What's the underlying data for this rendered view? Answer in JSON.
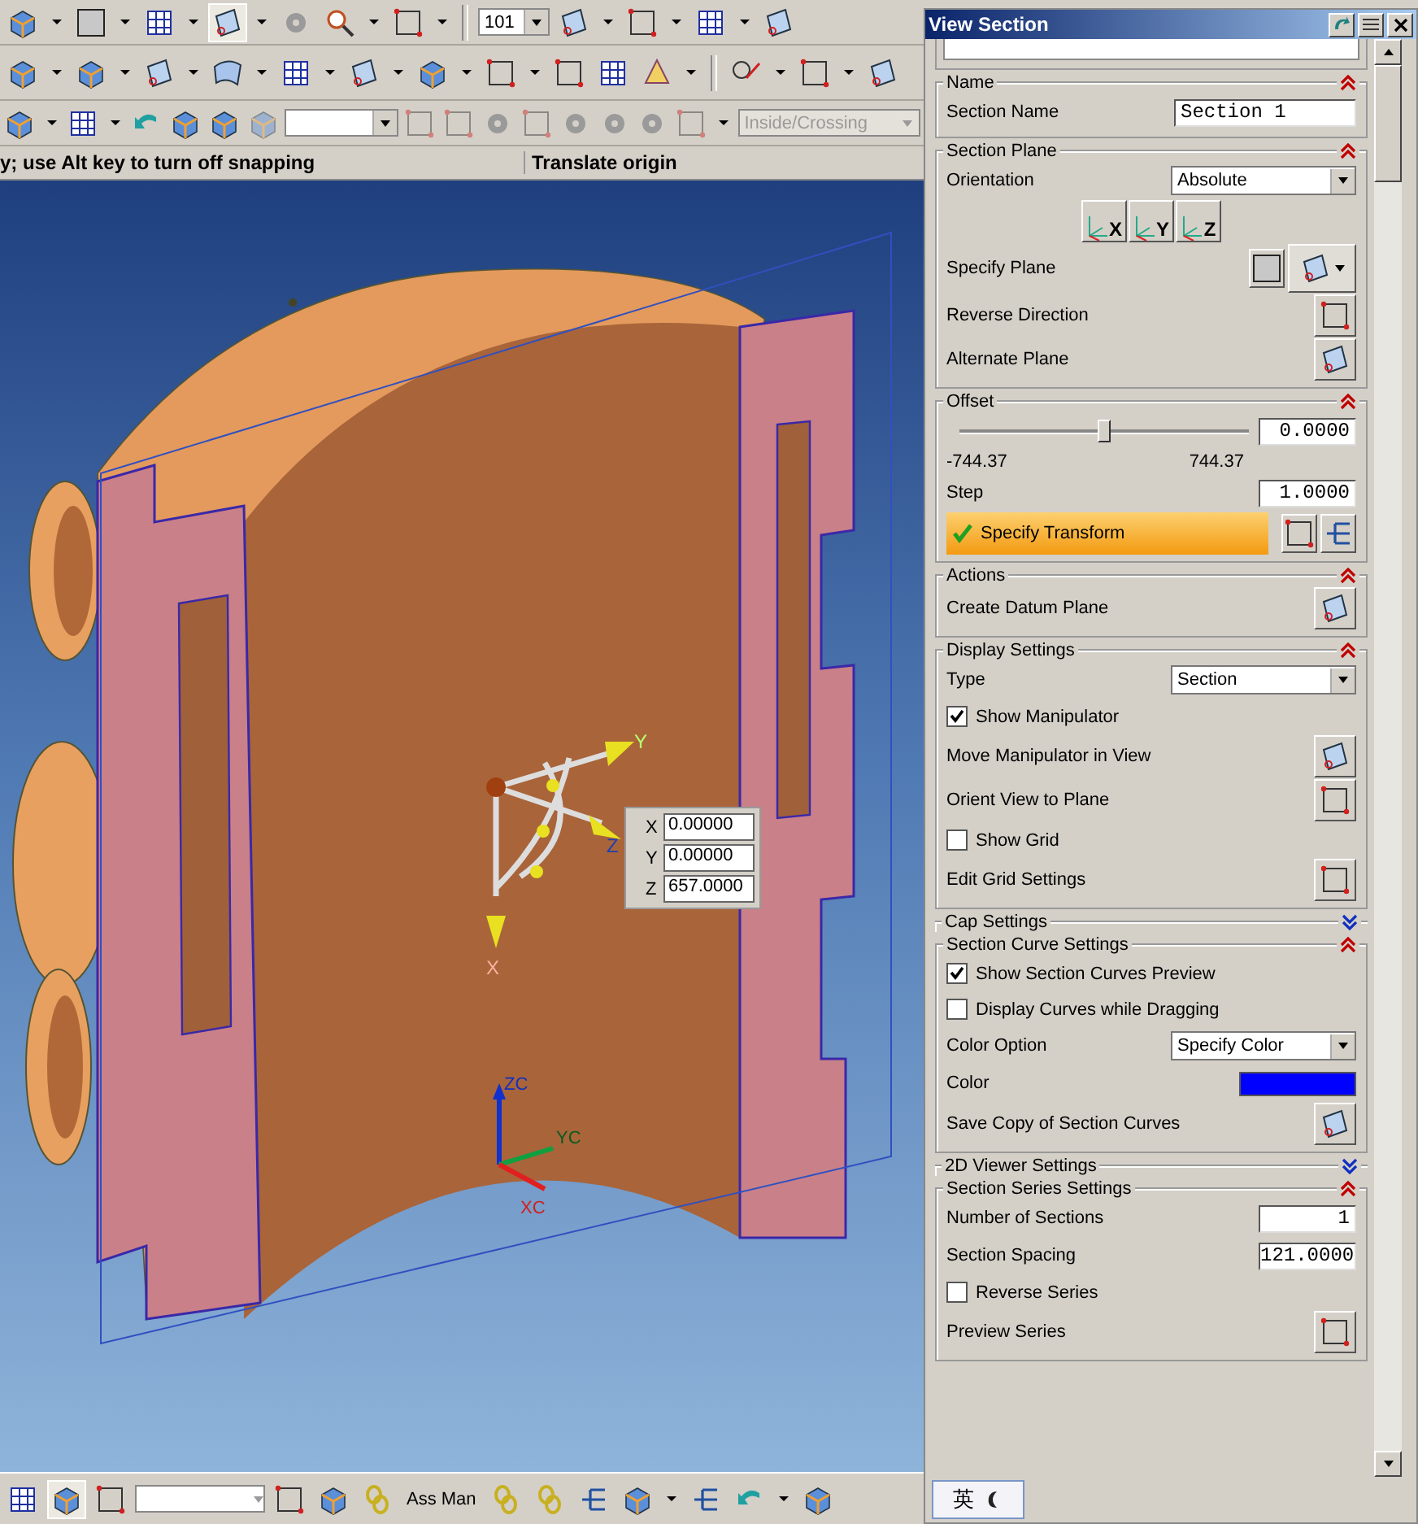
{
  "toolbar": {
    "layer": "101",
    "selection_filter": "Inside/Crossing"
  },
  "status_bar": {
    "prompt": "y; use Alt key to turn off snapping",
    "status": "Translate origin"
  },
  "viewport": {
    "manipulator_axes": [
      "Y",
      "Z",
      "X"
    ],
    "coordinates": [
      {
        "label": "X",
        "value": "0.00000"
      },
      {
        "label": "Y",
        "value": "0.00000"
      },
      {
        "label": "Z",
        "value": "657.0000"
      }
    ],
    "triad_axes": [
      "ZC",
      "YC",
      "XC"
    ]
  },
  "bottom_toolbar": {
    "assembly_button": "Ass Man"
  },
  "dialog": {
    "title": "View Section",
    "groups": [
      {
        "title": "Name",
        "expanded": true,
        "rows": [
          {
            "kind": "text_field",
            "label": "Section Name",
            "value": "Section 1"
          }
        ]
      },
      {
        "title": "Section Plane",
        "expanded": true,
        "rows": [
          {
            "kind": "dropdown",
            "label": "Orientation",
            "value": "Absolute"
          },
          {
            "kind": "axis_buttons",
            "labels": [
              "X",
              "Y",
              "Z"
            ]
          },
          {
            "kind": "plane_selector",
            "label": "Specify Plane"
          },
          {
            "kind": "icon_button",
            "label": "Reverse Direction"
          },
          {
            "kind": "icon_button",
            "label": "Alternate Plane"
          }
        ]
      },
      {
        "title": "Offset",
        "expanded": true,
        "rows": [
          {
            "kind": "slider",
            "level": 0.5,
            "min": "-744.37",
            "max": "744.37",
            "value": "0.0000"
          },
          {
            "kind": "number_field",
            "label": "Step",
            "value": "1.0000"
          },
          {
            "kind": "transform",
            "label": "Specify Transform",
            "done": true
          }
        ]
      },
      {
        "title": "Actions",
        "expanded": true,
        "rows": [
          {
            "kind": "icon_button",
            "label": "Create Datum Plane"
          }
        ]
      },
      {
        "title": "Display Settings",
        "expanded": true,
        "rows": [
          {
            "kind": "dropdown",
            "label": "Type",
            "value": "Section"
          },
          {
            "kind": "checkbox",
            "label": "Show Manipulator",
            "checked": true
          },
          {
            "kind": "icon_button",
            "label": "Move Manipulator in View"
          },
          {
            "kind": "icon_button",
            "label": "Orient View to Plane"
          },
          {
            "kind": "checkbox",
            "label": "Show Grid",
            "checked": false
          },
          {
            "kind": "icon_button",
            "label": "Edit Grid Settings"
          }
        ]
      },
      {
        "title": "Cap Settings",
        "expanded": false
      },
      {
        "title": "Section Curve Settings",
        "expanded": true,
        "rows": [
          {
            "kind": "checkbox",
            "label": "Show Section Curves Preview",
            "checked": true
          },
          {
            "kind": "checkbox",
            "label": "Display Curves while Dragging",
            "checked": false
          },
          {
            "kind": "dropdown",
            "label": "Color Option",
            "value": "Specify Color"
          },
          {
            "kind": "color",
            "label": "Color",
            "color": "#0000ff"
          },
          {
            "kind": "icon_button",
            "label": "Save Copy of Section Curves"
          }
        ]
      },
      {
        "title": "2D Viewer Settings",
        "expanded": false
      },
      {
        "title": "Section Series Settings",
        "expanded": true,
        "rows": [
          {
            "kind": "number_field",
            "label": "Number of Sections",
            "value": "1"
          },
          {
            "kind": "number_field",
            "label": "Section Spacing",
            "value": "121.0000"
          },
          {
            "kind": "checkbox",
            "label": "Reverse Series",
            "checked": false
          },
          {
            "kind": "icon_button",
            "label": "Preview Series"
          }
        ]
      }
    ]
  },
  "language_bar": {
    "label": "英"
  }
}
